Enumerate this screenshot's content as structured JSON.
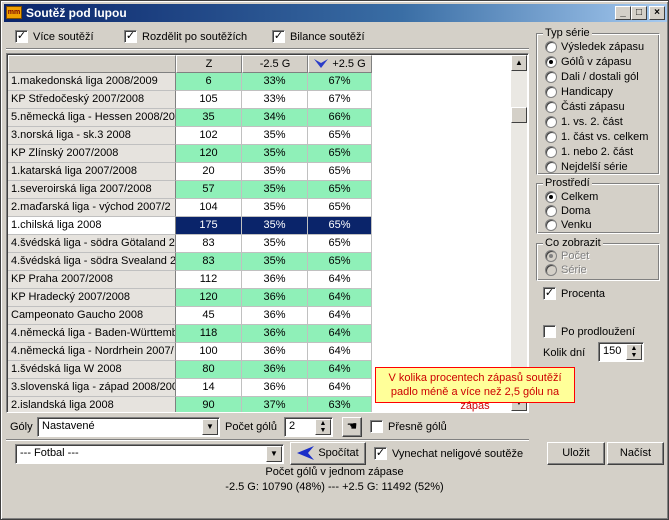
{
  "window": {
    "icon_text": "mm",
    "title": "Soutěž pod lupou",
    "min_icon": "minimize-icon",
    "max_icon": "maximize-icon",
    "close_icon": "close-icon"
  },
  "top_checks": [
    {
      "label": "Více soutěží",
      "checked": true
    },
    {
      "label": "Rozdělit po soutěžích",
      "checked": true
    },
    {
      "label": "Bilance soutěží",
      "checked": true
    }
  ],
  "table": {
    "headers": [
      "",
      "Z",
      "-2.5 G",
      "+2.5 G"
    ],
    "sort_icon": "sort-down-icon",
    "rows": [
      {
        "name": "1.makedonská liga 2008/2009",
        "z": "6",
        "minus": "33%",
        "plus": "67%",
        "style": "green"
      },
      {
        "name": "KP Středočeský 2007/2008",
        "z": "105",
        "minus": "33%",
        "plus": "67%",
        "style": "white"
      },
      {
        "name": "5.německá liga - Hessen 2008/20",
        "z": "35",
        "minus": "34%",
        "plus": "66%",
        "style": "green"
      },
      {
        "name": "3.norská liga - sk.3 2008",
        "z": "102",
        "minus": "35%",
        "plus": "65%",
        "style": "white"
      },
      {
        "name": "KP Zlínský 2007/2008",
        "z": "120",
        "minus": "35%",
        "plus": "65%",
        "style": "green"
      },
      {
        "name": "1.katarská liga 2007/2008",
        "z": "20",
        "minus": "35%",
        "plus": "65%",
        "style": "white"
      },
      {
        "name": "1.severoirská liga 2007/2008",
        "z": "57",
        "minus": "35%",
        "plus": "65%",
        "style": "green"
      },
      {
        "name": "2.maďarská liga - východ 2007/2",
        "z": "104",
        "minus": "35%",
        "plus": "65%",
        "style": "white"
      },
      {
        "name": "1.chilská liga 2008",
        "z": "175",
        "minus": "35%",
        "plus": "65%",
        "style": "sel"
      },
      {
        "name": "4.švédská liga - södra Götaland 2",
        "z": "83",
        "minus": "35%",
        "plus": "65%",
        "style": "white"
      },
      {
        "name": "4.švédská liga - södra Svealand 2",
        "z": "83",
        "minus": "35%",
        "plus": "65%",
        "style": "green"
      },
      {
        "name": "KP Praha 2007/2008",
        "z": "112",
        "minus": "36%",
        "plus": "64%",
        "style": "white"
      },
      {
        "name": "KP Hradecký 2007/2008",
        "z": "120",
        "minus": "36%",
        "plus": "64%",
        "style": "green"
      },
      {
        "name": "Campeonato Gaucho 2008",
        "z": "45",
        "minus": "36%",
        "plus": "64%",
        "style": "white"
      },
      {
        "name": "4.německá liga - Baden-Württemb",
        "z": "118",
        "minus": "36%",
        "plus": "64%",
        "style": "green"
      },
      {
        "name": "4.německá liga - Nordrhein 2007/",
        "z": "100",
        "minus": "36%",
        "plus": "64%",
        "style": "white"
      },
      {
        "name": "1.švédská liga W 2008",
        "z": "80",
        "minus": "36%",
        "plus": "64%",
        "style": "green"
      },
      {
        "name": "3.slovenská liga - západ 2008/200",
        "z": "14",
        "minus": "36%",
        "plus": "64%",
        "style": "white"
      },
      {
        "name": "2.islandská liga 2008",
        "z": "90",
        "minus": "37%",
        "plus": "63%",
        "style": "green"
      }
    ]
  },
  "tooltip": {
    "line1": "V kolika procentech zápasů soutěží",
    "line2": "padlo méně a více než 2,5 gólu na zápas"
  },
  "bottom_row1": {
    "goly_label": "Góly",
    "goly_value": "Nastavené",
    "pocet_label": "Počet gólů",
    "pocet_value": "2",
    "presne_label": "Přesně gólů"
  },
  "bottom_row2": {
    "sport_value": "--- Fotbal ---",
    "spocitat_label": "Spočítat",
    "vynechat_label": "Vynechat neligové soutěže",
    "ulozit_label": "Uložit",
    "nacist_label": "Načíst"
  },
  "right": {
    "typ_title": "Typ série",
    "typ_items": [
      {
        "label": "Výsledek zápasu",
        "on": false
      },
      {
        "label": "Gólů v zápasu",
        "on": true
      },
      {
        "label": "Dali / dostali gól",
        "on": false
      },
      {
        "label": "Handicapy",
        "on": false
      },
      {
        "label": "Části zápasu",
        "on": false
      },
      {
        "label": "1. vs. 2. část",
        "on": false
      },
      {
        "label": "1. část vs. celkem",
        "on": false
      },
      {
        "label": "1. nebo 2. část",
        "on": false
      },
      {
        "label": "Nejdelší série",
        "on": false
      }
    ],
    "prostredi_title": "Prostředí",
    "prostredi_items": [
      {
        "label": "Celkem",
        "on": true
      },
      {
        "label": "Doma",
        "on": false
      },
      {
        "label": "Venku",
        "on": false
      }
    ],
    "zobrazit_title": "Co zobrazit",
    "zobrazit_items": [
      {
        "label": "Počet",
        "on": true
      },
      {
        "label": "Série",
        "on": false
      }
    ],
    "procenta_label": "Procenta",
    "prodlouzeni_label": "Po prodloužení",
    "kolik_label": "Kolik dní",
    "kolik_value": "150"
  },
  "status": {
    "line1": "Počet gólů v jednom zápase",
    "line2": "-2.5 G: 10790 (48%) --- +2.5 G: 11492 (52%)"
  }
}
